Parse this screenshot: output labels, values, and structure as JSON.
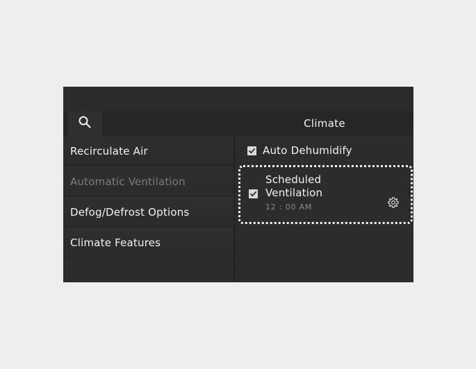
{
  "header": {
    "title": "Climate",
    "search_icon": "search-icon"
  },
  "menu": {
    "items": [
      {
        "label": "Recirculate Air",
        "enabled": true
      },
      {
        "label": "Automatic Ventilation",
        "enabled": false
      },
      {
        "label": "Defog/Defrost Options",
        "enabled": true
      },
      {
        "label": "Climate Features",
        "enabled": true
      }
    ]
  },
  "options": {
    "auto_dehumidify": {
      "label": "Auto Dehumidify",
      "checked": true
    },
    "scheduled_ventilation": {
      "label_line1": "Scheduled",
      "label_line2": "Ventilation",
      "time": "12 : 00 AM",
      "checked": true,
      "settings_icon": "gear-icon"
    }
  }
}
